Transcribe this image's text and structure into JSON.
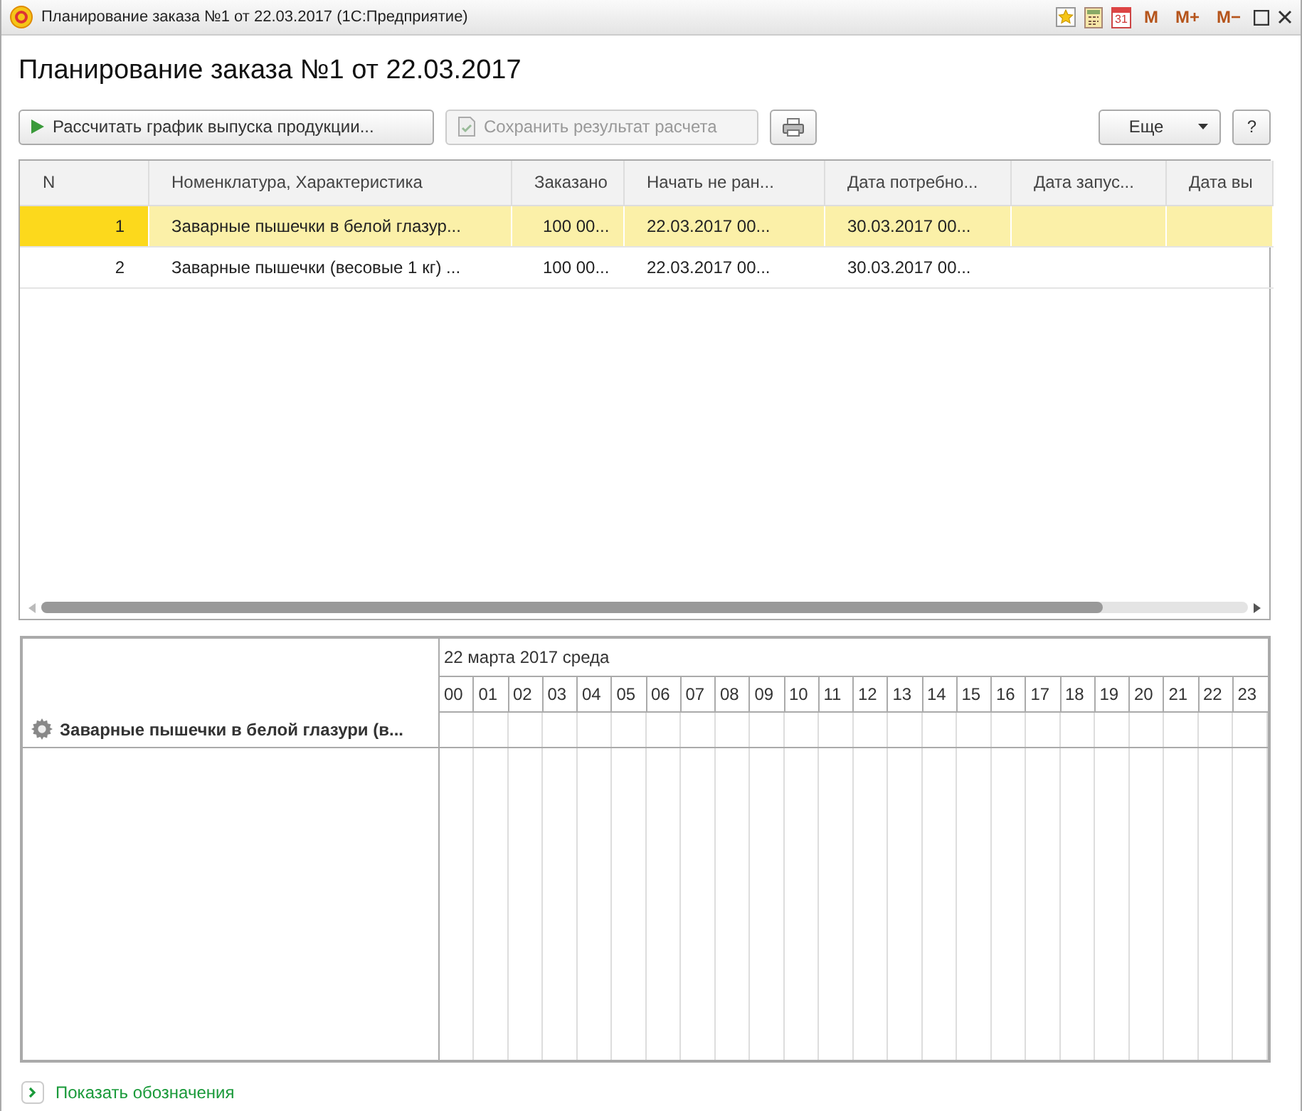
{
  "window": {
    "title": "Планирование заказа №1 от 22.03.2017  (1С:Предприятие)",
    "calendar_day": "31",
    "memory_buttons": [
      "M",
      "M+",
      "M−"
    ]
  },
  "heading": "Планирование заказа №1 от 22.03.2017",
  "toolbar": [
    {
      "kind": "play",
      "label": "Рассчитать график выпуска продукции...",
      "disabled": false
    },
    {
      "kind": "save",
      "label": "Сохранить результат расчета",
      "disabled": true
    },
    {
      "kind": "print",
      "disabled": false
    }
  ],
  "more_button": "Еще",
  "help_button": "?",
  "table": {
    "columns": [
      "N",
      "Номенклатура, Характеристика",
      "Заказано",
      "Начать не ран...",
      "Дата потребно...",
      "Дата запус...",
      "Дата вы"
    ],
    "rows": [
      {
        "selected": true,
        "cells": [
          "1",
          "Заварные пышечки в белой глазур...",
          "100 00...",
          "22.03.2017 00...",
          "30.03.2017 00...",
          "",
          ""
        ]
      },
      {
        "selected": false,
        "cells": [
          "2",
          "Заварные пышечки (весовые 1 кг) ...",
          "100 00...",
          "22.03.2017 00...",
          "30.03.2017 00...",
          "",
          ""
        ]
      }
    ]
  },
  "gantt": {
    "date": "22 марта 2017 среда",
    "hours": [
      "00",
      "01",
      "02",
      "03",
      "04",
      "05",
      "06",
      "07",
      "08",
      "09",
      "10",
      "11",
      "12",
      "13",
      "14",
      "15",
      "16",
      "17",
      "18",
      "19",
      "20",
      "21",
      "22",
      "23"
    ],
    "items": [
      "Заварные пышечки в белой глазури (в..."
    ]
  },
  "legend_link": "Показать обозначения"
}
